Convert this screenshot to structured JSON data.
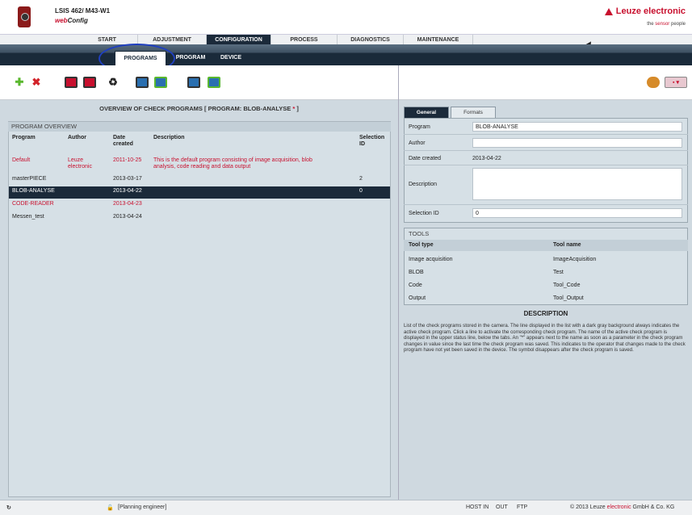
{
  "header": {
    "device": "LSIS 462/ M43-W1",
    "app_web": "web",
    "app_config": "Config",
    "brand": "Leuze electronic",
    "tagline_pre": "the ",
    "tagline_red": "sensor",
    "tagline_post": " people"
  },
  "topnav": [
    "START",
    "ADJUSTMENT",
    "CONFIGURATION",
    "PROCESS",
    "DIAGNOSTICS",
    "MAINTENANCE"
  ],
  "subnav": [
    "PROGRAMS",
    "PROGRAM",
    "DEVICE"
  ],
  "overview": {
    "heading": "OVERVIEW OF CHECK PROGRAMS   [ PROGRAM: BLOB-ANALYSE ",
    "heading_star": "*",
    "heading_end": " ]",
    "title": "PROGRAM OVERVIEW",
    "columns": {
      "program": "Program",
      "author": "Author",
      "date_1": "Date",
      "date_2": "created",
      "description": "Description",
      "selection_1": "Selection",
      "selection_2": "ID"
    },
    "rows": [
      {
        "program": "Default",
        "author_1": "Leuze",
        "author_2": "electronic",
        "date": "2011-10-25",
        "desc_1": "This is the default program consisting of image acquisition, blob",
        "desc_2": "analysis, code reading and data output",
        "sel": ""
      },
      {
        "program": "masterPIECE",
        "author_1": "",
        "author_2": "",
        "date": "2013-03-17",
        "desc_1": "",
        "desc_2": "",
        "sel": "2"
      },
      {
        "program": "BLOB-ANALYSE",
        "author_1": "",
        "author_2": "",
        "date": "2013-04-22",
        "desc_1": "",
        "desc_2": "",
        "sel": "0"
      },
      {
        "program": "CODE-READER",
        "author_1": "",
        "author_2": "",
        "date": "2013-04-23",
        "desc_1": "",
        "desc_2": "",
        "sel": ""
      },
      {
        "program": "Messen_test",
        "author_1": "",
        "author_2": "",
        "date": "2013-04-24",
        "desc_1": "",
        "desc_2": "",
        "sel": ""
      }
    ]
  },
  "details": {
    "tabs": [
      "General",
      "Formats"
    ],
    "labels": {
      "program": "Program",
      "author": "Author",
      "date": "Date created",
      "description": "Description",
      "selection": "Selection ID"
    },
    "values": {
      "program": "BLOB-ANALYSE",
      "author": "",
      "date": "2013-04-22",
      "description": "",
      "selection": "0"
    }
  },
  "tools": {
    "title": "TOOLS",
    "col_type": "Tool type",
    "col_name": "Tool name",
    "rows": [
      {
        "type": "Image acquisition",
        "name": "ImageAcquisition"
      },
      {
        "type": "BLOB",
        "name": "Test"
      },
      {
        "type": "Code",
        "name": "Tool_Code"
      },
      {
        "type": "Output",
        "name": "Tool_Output"
      }
    ]
  },
  "description": {
    "heading": "DESCRIPTION",
    "text": "List of the check programs stored in the camera. The line displayed in the list with a dark gray background always indicates the active check program. Click a line to activate the corresponding check program. The name of the active check program is displayed in the upper status line, below the tabs. An \"*\" appears next to the name as soon as a parameter in the check program changes in value since the last time the check program was saved. This indicates to the operator that changes made to the check program have not yet been saved in the device. The symbol disappears after the check program is saved."
  },
  "status": {
    "user": "[Planning engineer]",
    "host_in": "HOST IN",
    "out": "OUT",
    "ftp": "FTP",
    "copyright_pre": "© 2013 Leuze ",
    "copyright_red": "electronic",
    "copyright_post": " GmbH & Co. KG"
  },
  "colors": {
    "brand_red": "#c8102e",
    "dark_navy": "#1b2a3a",
    "panel_blue": "#cfd9e0",
    "highlight_ellipse": "#1f3fbf"
  },
  "icons": [
    "add-icon",
    "delete-icon",
    "save-red-icon",
    "save-as-icon",
    "recycle-icon",
    "download-icon",
    "upload-icon",
    "export-icon",
    "import-icon",
    "users-icon",
    "language-flag-icon"
  ]
}
